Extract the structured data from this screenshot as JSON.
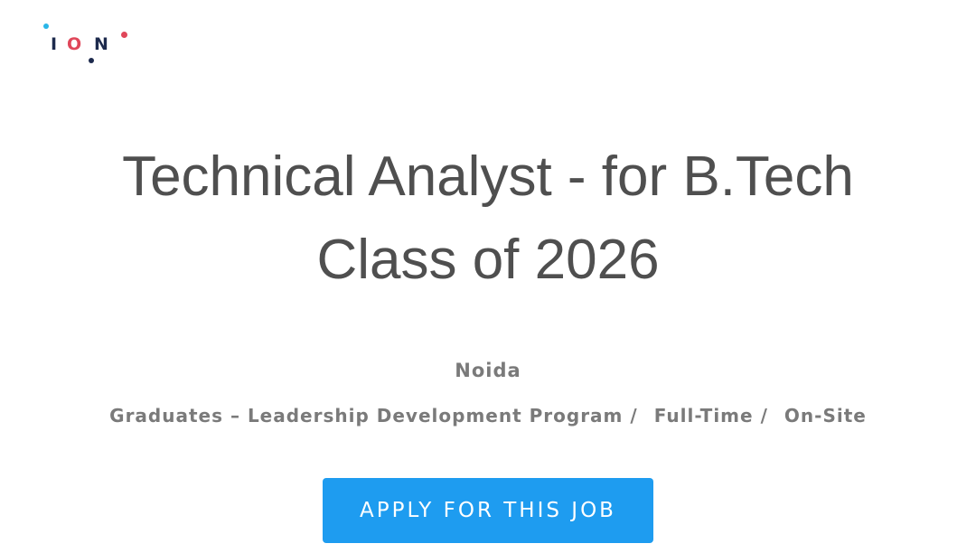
{
  "header": {
    "logo": {
      "text": "ION",
      "letters": [
        "I",
        "O",
        "N"
      ],
      "colors": {
        "dark": "#1d2a4d",
        "red": "#e0475a",
        "cyan": "#2ab6e8"
      }
    }
  },
  "posting": {
    "title": "Technical Analyst - for B.Tech Class of 2026",
    "location": "Noida",
    "categories": [
      "Graduates – Leadership Development Program",
      "Full-Time",
      "On-Site"
    ],
    "separator": "/"
  },
  "actions": {
    "apply_label": "APPLY FOR THIS JOB"
  },
  "theme": {
    "accent": "#1e9cf0",
    "text": "#4f4f4f",
    "muted": "#7a7a7a"
  }
}
